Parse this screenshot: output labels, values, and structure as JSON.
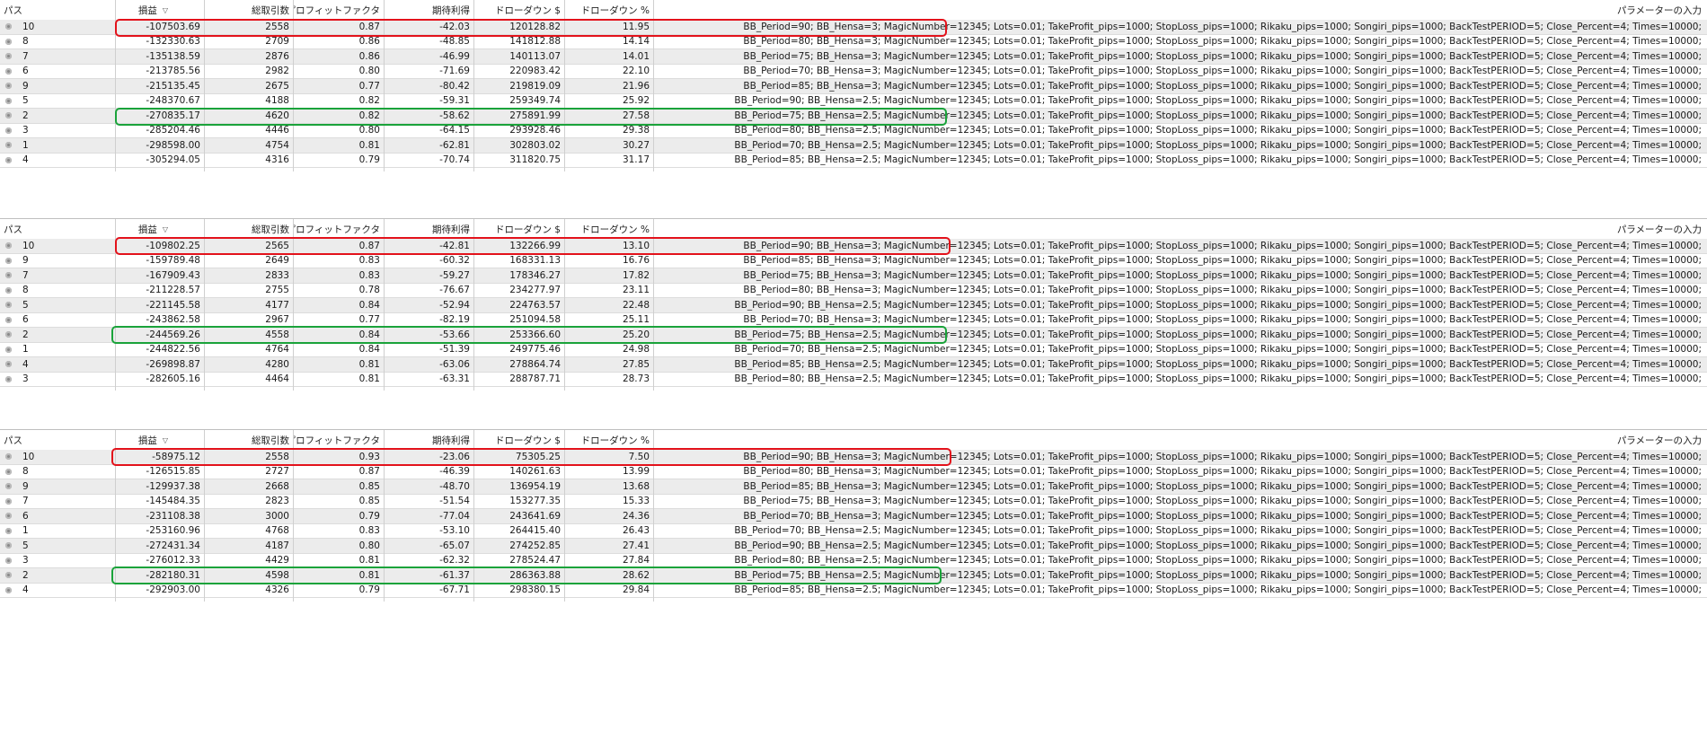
{
  "columns": {
    "pass": "パス",
    "profit": "損益",
    "trades": "総取引数",
    "pf": "プロフィットファクタ",
    "expected": "期待利得",
    "dd_dollar": "ドローダウン $",
    "dd_pct": "ドローダウン %",
    "params": "パラメーターの入力"
  },
  "colors": {
    "red_highlight": "#e3121b",
    "green_highlight": "#1aa33a",
    "row_alt": "#ececec"
  },
  "tables": [
    {
      "rows": [
        {
          "pass": "10",
          "profit": "-107503.69",
          "trades": "2558",
          "pf": "0.87",
          "expected": "-42.03",
          "dd_dollar": "120128.82",
          "dd_pct": "11.95",
          "params": "BB_Period=90; BB_Hensa=3; MagicNumber=12345; Lots=0.01; TakeProfit_pips=1000; StopLoss_pips=1000; Rikaku_pips=1000; Songiri_pips=1000; BackTestPERIOD=5; Close_Percent=4; Times=10000;"
        },
        {
          "pass": "8",
          "profit": "-132330.63",
          "trades": "2709",
          "pf": "0.86",
          "expected": "-48.85",
          "dd_dollar": "141812.88",
          "dd_pct": "14.14",
          "params": "BB_Period=80; BB_Hensa=3; MagicNumber=12345; Lots=0.01; TakeProfit_pips=1000; StopLoss_pips=1000; Rikaku_pips=1000; Songiri_pips=1000; BackTestPERIOD=5; Close_Percent=4; Times=10000;"
        },
        {
          "pass": "7",
          "profit": "-135138.59",
          "trades": "2876",
          "pf": "0.86",
          "expected": "-46.99",
          "dd_dollar": "140113.07",
          "dd_pct": "14.01",
          "params": "BB_Period=75; BB_Hensa=3; MagicNumber=12345; Lots=0.01; TakeProfit_pips=1000; StopLoss_pips=1000; Rikaku_pips=1000; Songiri_pips=1000; BackTestPERIOD=5; Close_Percent=4; Times=10000;"
        },
        {
          "pass": "6",
          "profit": "-213785.56",
          "trades": "2982",
          "pf": "0.80",
          "expected": "-71.69",
          "dd_dollar": "220983.42",
          "dd_pct": "22.10",
          "params": "BB_Period=70; BB_Hensa=3; MagicNumber=12345; Lots=0.01; TakeProfit_pips=1000; StopLoss_pips=1000; Rikaku_pips=1000; Songiri_pips=1000; BackTestPERIOD=5; Close_Percent=4; Times=10000;"
        },
        {
          "pass": "9",
          "profit": "-215135.45",
          "trades": "2675",
          "pf": "0.77",
          "expected": "-80.42",
          "dd_dollar": "219819.09",
          "dd_pct": "21.96",
          "params": "BB_Period=85; BB_Hensa=3; MagicNumber=12345; Lots=0.01; TakeProfit_pips=1000; StopLoss_pips=1000; Rikaku_pips=1000; Songiri_pips=1000; BackTestPERIOD=5; Close_Percent=4; Times=10000;"
        },
        {
          "pass": "5",
          "profit": "-248370.67",
          "trades": "4188",
          "pf": "0.82",
          "expected": "-59.31",
          "dd_dollar": "259349.74",
          "dd_pct": "25.92",
          "params": "BB_Period=90; BB_Hensa=2.5; MagicNumber=12345; Lots=0.01; TakeProfit_pips=1000; StopLoss_pips=1000; Rikaku_pips=1000; Songiri_pips=1000; BackTestPERIOD=5; Close_Percent=4; Times=10000;"
        },
        {
          "pass": "2",
          "profit": "-270835.17",
          "trades": "4620",
          "pf": "0.82",
          "expected": "-58.62",
          "dd_dollar": "275891.99",
          "dd_pct": "27.58",
          "params": "BB_Period=75; BB_Hensa=2.5; MagicNumber=12345; Lots=0.01; TakeProfit_pips=1000; StopLoss_pips=1000; Rikaku_pips=1000; Songiri_pips=1000; BackTestPERIOD=5; Close_Percent=4; Times=10000;"
        },
        {
          "pass": "3",
          "profit": "-285204.46",
          "trades": "4446",
          "pf": "0.80",
          "expected": "-64.15",
          "dd_dollar": "293928.46",
          "dd_pct": "29.38",
          "params": "BB_Period=80; BB_Hensa=2.5; MagicNumber=12345; Lots=0.01; TakeProfit_pips=1000; StopLoss_pips=1000; Rikaku_pips=1000; Songiri_pips=1000; BackTestPERIOD=5; Close_Percent=4; Times=10000;"
        },
        {
          "pass": "1",
          "profit": "-298598.00",
          "trades": "4754",
          "pf": "0.81",
          "expected": "-62.81",
          "dd_dollar": "302803.02",
          "dd_pct": "30.27",
          "params": "BB_Period=70; BB_Hensa=2.5; MagicNumber=12345; Lots=0.01; TakeProfit_pips=1000; StopLoss_pips=1000; Rikaku_pips=1000; Songiri_pips=1000; BackTestPERIOD=5; Close_Percent=4; Times=10000;"
        },
        {
          "pass": "4",
          "profit": "-305294.05",
          "trades": "4316",
          "pf": "0.79",
          "expected": "-70.74",
          "dd_dollar": "311820.75",
          "dd_pct": "31.17",
          "params": "BB_Period=85; BB_Hensa=2.5; MagicNumber=12345; Lots=0.01; TakeProfit_pips=1000; StopLoss_pips=1000; Rikaku_pips=1000; Songiri_pips=1000; BackTestPERIOD=5; Close_Percent=4; Times=10000;"
        }
      ]
    },
    {
      "rows": [
        {
          "pass": "10",
          "profit": "-109802.25",
          "trades": "2565",
          "pf": "0.87",
          "expected": "-42.81",
          "dd_dollar": "132266.99",
          "dd_pct": "13.10",
          "params": "BB_Period=90; BB_Hensa=3; MagicNumber=12345; Lots=0.01; TakeProfit_pips=1000; StopLoss_pips=1000; Rikaku_pips=1000; Songiri_pips=1000; BackTestPERIOD=5; Close_Percent=4; Times=10000;"
        },
        {
          "pass": "9",
          "profit": "-159789.48",
          "trades": "2649",
          "pf": "0.83",
          "expected": "-60.32",
          "dd_dollar": "168331.13",
          "dd_pct": "16.76",
          "params": "BB_Period=85; BB_Hensa=3; MagicNumber=12345; Lots=0.01; TakeProfit_pips=1000; StopLoss_pips=1000; Rikaku_pips=1000; Songiri_pips=1000; BackTestPERIOD=5; Close_Percent=4; Times=10000;"
        },
        {
          "pass": "7",
          "profit": "-167909.43",
          "trades": "2833",
          "pf": "0.83",
          "expected": "-59.27",
          "dd_dollar": "178346.27",
          "dd_pct": "17.82",
          "params": "BB_Period=75; BB_Hensa=3; MagicNumber=12345; Lots=0.01; TakeProfit_pips=1000; StopLoss_pips=1000; Rikaku_pips=1000; Songiri_pips=1000; BackTestPERIOD=5; Close_Percent=4; Times=10000;"
        },
        {
          "pass": "8",
          "profit": "-211228.57",
          "trades": "2755",
          "pf": "0.78",
          "expected": "-76.67",
          "dd_dollar": "234277.97",
          "dd_pct": "23.11",
          "params": "BB_Period=80; BB_Hensa=3; MagicNumber=12345; Lots=0.01; TakeProfit_pips=1000; StopLoss_pips=1000; Rikaku_pips=1000; Songiri_pips=1000; BackTestPERIOD=5; Close_Percent=4; Times=10000;"
        },
        {
          "pass": "5",
          "profit": "-221145.58",
          "trades": "4177",
          "pf": "0.84",
          "expected": "-52.94",
          "dd_dollar": "224763.57",
          "dd_pct": "22.48",
          "params": "BB_Period=90; BB_Hensa=2.5; MagicNumber=12345; Lots=0.01; TakeProfit_pips=1000; StopLoss_pips=1000; Rikaku_pips=1000; Songiri_pips=1000; BackTestPERIOD=5; Close_Percent=4; Times=10000;"
        },
        {
          "pass": "6",
          "profit": "-243862.58",
          "trades": "2967",
          "pf": "0.77",
          "expected": "-82.19",
          "dd_dollar": "251094.58",
          "dd_pct": "25.11",
          "params": "BB_Period=70; BB_Hensa=3; MagicNumber=12345; Lots=0.01; TakeProfit_pips=1000; StopLoss_pips=1000; Rikaku_pips=1000; Songiri_pips=1000; BackTestPERIOD=5; Close_Percent=4; Times=10000;"
        },
        {
          "pass": "2",
          "profit": "-244569.26",
          "trades": "4558",
          "pf": "0.84",
          "expected": "-53.66",
          "dd_dollar": "253366.60",
          "dd_pct": "25.20",
          "params": "BB_Period=75; BB_Hensa=2.5; MagicNumber=12345; Lots=0.01; TakeProfit_pips=1000; StopLoss_pips=1000; Rikaku_pips=1000; Songiri_pips=1000; BackTestPERIOD=5; Close_Percent=4; Times=10000;"
        },
        {
          "pass": "1",
          "profit": "-244822.56",
          "trades": "4764",
          "pf": "0.84",
          "expected": "-51.39",
          "dd_dollar": "249775.46",
          "dd_pct": "24.98",
          "params": "BB_Period=70; BB_Hensa=2.5; MagicNumber=12345; Lots=0.01; TakeProfit_pips=1000; StopLoss_pips=1000; Rikaku_pips=1000; Songiri_pips=1000; BackTestPERIOD=5; Close_Percent=4; Times=10000;"
        },
        {
          "pass": "4",
          "profit": "-269898.87",
          "trades": "4280",
          "pf": "0.81",
          "expected": "-63.06",
          "dd_dollar": "278864.74",
          "dd_pct": "27.85",
          "params": "BB_Period=85; BB_Hensa=2.5; MagicNumber=12345; Lots=0.01; TakeProfit_pips=1000; StopLoss_pips=1000; Rikaku_pips=1000; Songiri_pips=1000; BackTestPERIOD=5; Close_Percent=4; Times=10000;"
        },
        {
          "pass": "3",
          "profit": "-282605.16",
          "trades": "4464",
          "pf": "0.81",
          "expected": "-63.31",
          "dd_dollar": "288787.71",
          "dd_pct": "28.73",
          "params": "BB_Period=80; BB_Hensa=2.5; MagicNumber=12345; Lots=0.01; TakeProfit_pips=1000; StopLoss_pips=1000; Rikaku_pips=1000; Songiri_pips=1000; BackTestPERIOD=5; Close_Percent=4; Times=10000;"
        }
      ]
    },
    {
      "rows": [
        {
          "pass": "10",
          "profit": "-58975.12",
          "trades": "2558",
          "pf": "0.93",
          "expected": "-23.06",
          "dd_dollar": "75305.25",
          "dd_pct": "7.50",
          "params": "BB_Period=90; BB_Hensa=3; MagicNumber=12345; Lots=0.01; TakeProfit_pips=1000; StopLoss_pips=1000; Rikaku_pips=1000; Songiri_pips=1000; BackTestPERIOD=5; Close_Percent=4; Times=10000;"
        },
        {
          "pass": "8",
          "profit": "-126515.85",
          "trades": "2727",
          "pf": "0.87",
          "expected": "-46.39",
          "dd_dollar": "140261.63",
          "dd_pct": "13.99",
          "params": "BB_Period=80; BB_Hensa=3; MagicNumber=12345; Lots=0.01; TakeProfit_pips=1000; StopLoss_pips=1000; Rikaku_pips=1000; Songiri_pips=1000; BackTestPERIOD=5; Close_Percent=4; Times=10000;"
        },
        {
          "pass": "9",
          "profit": "-129937.38",
          "trades": "2668",
          "pf": "0.85",
          "expected": "-48.70",
          "dd_dollar": "136954.19",
          "dd_pct": "13.68",
          "params": "BB_Period=85; BB_Hensa=3; MagicNumber=12345; Lots=0.01; TakeProfit_pips=1000; StopLoss_pips=1000; Rikaku_pips=1000; Songiri_pips=1000; BackTestPERIOD=5; Close_Percent=4; Times=10000;"
        },
        {
          "pass": "7",
          "profit": "-145484.35",
          "trades": "2823",
          "pf": "0.85",
          "expected": "-51.54",
          "dd_dollar": "153277.35",
          "dd_pct": "15.33",
          "params": "BB_Period=75; BB_Hensa=3; MagicNumber=12345; Lots=0.01; TakeProfit_pips=1000; StopLoss_pips=1000; Rikaku_pips=1000; Songiri_pips=1000; BackTestPERIOD=5; Close_Percent=4; Times=10000;"
        },
        {
          "pass": "6",
          "profit": "-231108.38",
          "trades": "3000",
          "pf": "0.79",
          "expected": "-77.04",
          "dd_dollar": "243641.69",
          "dd_pct": "24.36",
          "params": "BB_Period=70; BB_Hensa=3; MagicNumber=12345; Lots=0.01; TakeProfit_pips=1000; StopLoss_pips=1000; Rikaku_pips=1000; Songiri_pips=1000; BackTestPERIOD=5; Close_Percent=4; Times=10000;"
        },
        {
          "pass": "1",
          "profit": "-253160.96",
          "trades": "4768",
          "pf": "0.83",
          "expected": "-53.10",
          "dd_dollar": "264415.40",
          "dd_pct": "26.43",
          "params": "BB_Period=70; BB_Hensa=2.5; MagicNumber=12345; Lots=0.01; TakeProfit_pips=1000; StopLoss_pips=1000; Rikaku_pips=1000; Songiri_pips=1000; BackTestPERIOD=5; Close_Percent=4; Times=10000;"
        },
        {
          "pass": "5",
          "profit": "-272431.34",
          "trades": "4187",
          "pf": "0.80",
          "expected": "-65.07",
          "dd_dollar": "274252.85",
          "dd_pct": "27.41",
          "params": "BB_Period=90; BB_Hensa=2.5; MagicNumber=12345; Lots=0.01; TakeProfit_pips=1000; StopLoss_pips=1000; Rikaku_pips=1000; Songiri_pips=1000; BackTestPERIOD=5; Close_Percent=4; Times=10000;"
        },
        {
          "pass": "3",
          "profit": "-276012.33",
          "trades": "4429",
          "pf": "0.81",
          "expected": "-62.32",
          "dd_dollar": "278524.47",
          "dd_pct": "27.84",
          "params": "BB_Period=80; BB_Hensa=2.5; MagicNumber=12345; Lots=0.01; TakeProfit_pips=1000; StopLoss_pips=1000; Rikaku_pips=1000; Songiri_pips=1000; BackTestPERIOD=5; Close_Percent=4; Times=10000;"
        },
        {
          "pass": "2",
          "profit": "-282180.31",
          "trades": "4598",
          "pf": "0.81",
          "expected": "-61.37",
          "dd_dollar": "286363.88",
          "dd_pct": "28.62",
          "params": "BB_Period=75; BB_Hensa=2.5; MagicNumber=12345; Lots=0.01; TakeProfit_pips=1000; StopLoss_pips=1000; Rikaku_pips=1000; Songiri_pips=1000; BackTestPERIOD=5; Close_Percent=4; Times=10000;"
        },
        {
          "pass": "4",
          "profit": "-292903.00",
          "trades": "4326",
          "pf": "0.79",
          "expected": "-67.71",
          "dd_dollar": "298380.15",
          "dd_pct": "29.84",
          "params": "BB_Period=85; BB_Hensa=2.5; MagicNumber=12345; Lots=0.01; TakeProfit_pips=1000; StopLoss_pips=1000; Rikaku_pips=1000; Songiri_pips=1000; BackTestPERIOD=5; Close_Percent=4; Times=10000;"
        }
      ]
    }
  ]
}
